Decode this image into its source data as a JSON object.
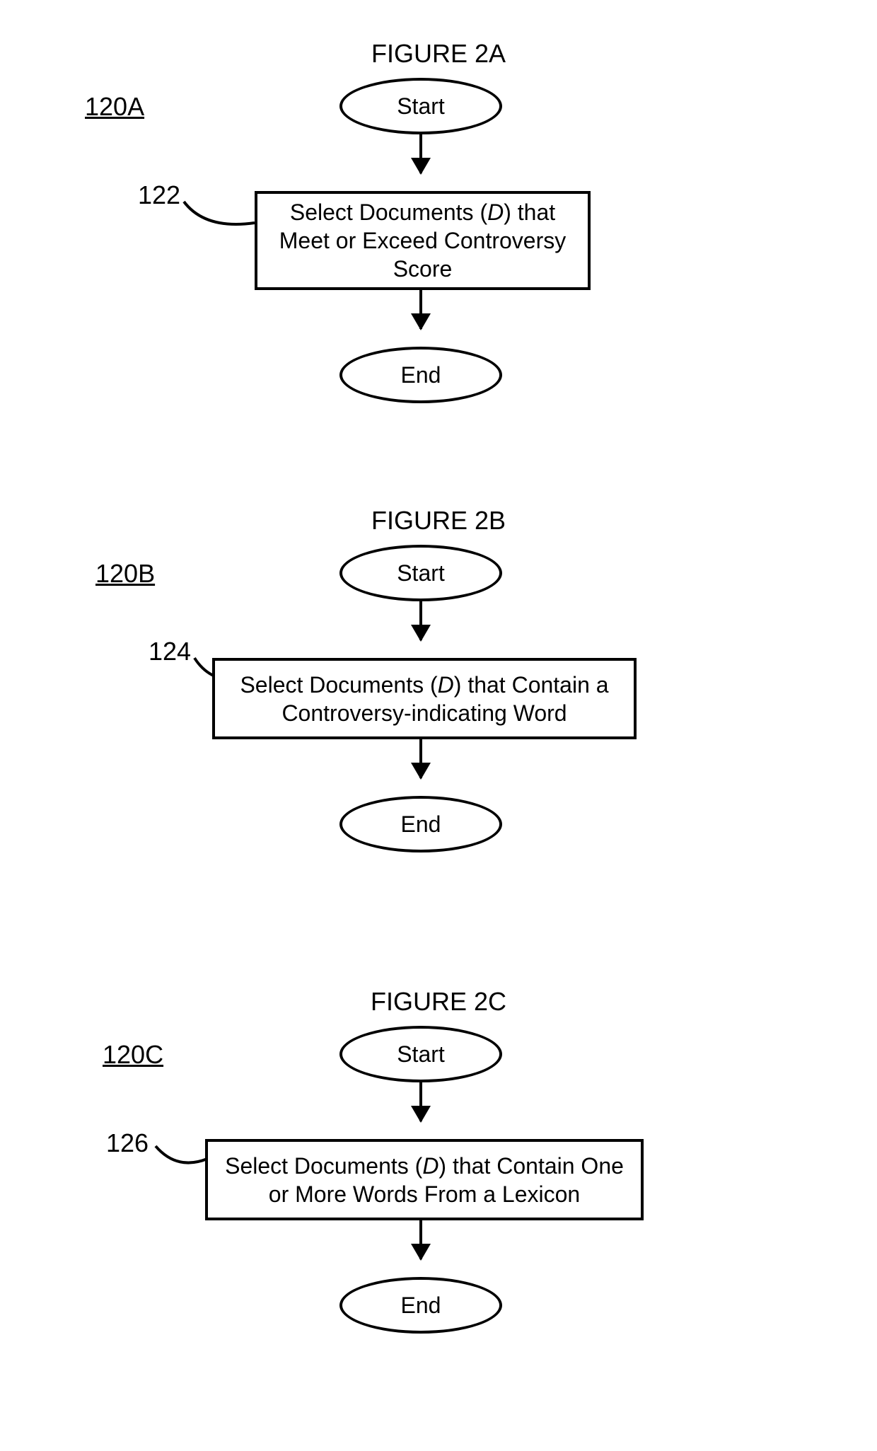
{
  "figures": [
    {
      "title": "FIGURE 2A",
      "label": "120A",
      "ref": "122",
      "start": "Start",
      "end": "End",
      "process_pre": "Select Documents (",
      "process_d": "D",
      "process_post": ") that Meet or Exceed Controversy Score"
    },
    {
      "title": "FIGURE 2B",
      "label": "120B",
      "ref": "124",
      "start": "Start",
      "end": "End",
      "process_pre": "Select Documents (",
      "process_d": "D",
      "process_post": ") that Contain a Controversy-indicating  Word"
    },
    {
      "title": "FIGURE 2C",
      "label": "120C",
      "ref": "126",
      "start": "Start",
      "end": "End",
      "process_pre": "Select Documents (",
      "process_d": "D",
      "process_post": ") that Contain One or More Words From a Lexicon"
    }
  ]
}
